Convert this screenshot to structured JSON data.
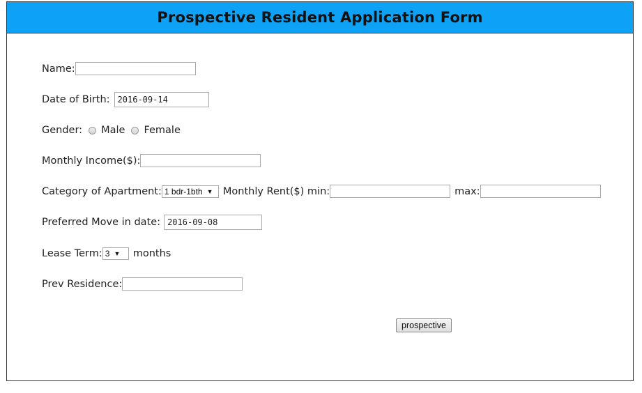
{
  "form": {
    "title": "Prospective Resident Application Form",
    "name_label": "Name:",
    "name_value": "",
    "dob_label": "Date of Birth:",
    "dob_value": "2016-09-14",
    "gender_label": "Gender:",
    "gender_male": "Male",
    "gender_female": "Female",
    "income_label": "Monthly Income($):",
    "income_value": "",
    "category_label": "Category of Apartment:",
    "category_selected": "1 bdr-1bth",
    "rent_label": "Monthly Rent($) min:",
    "rent_min_value": "",
    "rent_max_label": "max:",
    "rent_max_value": "",
    "move_label": "Preferred Move in date:",
    "move_value": "2016-09-08",
    "lease_label": "Lease Term:",
    "lease_selected": "3",
    "lease_unit": "months",
    "prev_label": "Prev Residence:",
    "prev_value": "",
    "submit_label": "prospective"
  },
  "colors": {
    "header_bg": "#0da2f5"
  }
}
